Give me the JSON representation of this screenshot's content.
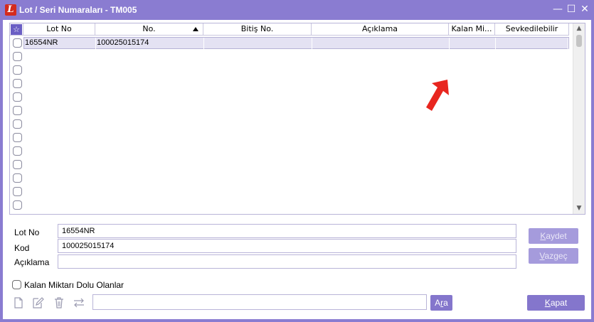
{
  "window": {
    "title": "Lot / Seri Numaraları - TM005",
    "app_icon_letter": "L",
    "minimize_glyph": "—",
    "maximize_glyph": "☐",
    "close_glyph": "✕"
  },
  "grid": {
    "star_glyph": "☆",
    "columns": [
      "Lot No",
      "No.",
      "Bitiş No.",
      "Açıklama",
      "Kalan Mi...",
      "Sevkedilebilir"
    ],
    "sorted_column": "No.",
    "rows": [
      {
        "lot_no": "16554NR",
        "no": "100025015174",
        "bitis_no": "",
        "aciklama": "",
        "kalan": "",
        "sevk": "",
        "checked": false,
        "selected": true
      }
    ],
    "empty_row_count": 12
  },
  "form": {
    "lot_no_label": "Lot No",
    "lot_no_value": "16554NR",
    "kod_label": "Kod",
    "kod_value": "100025015174",
    "aciklama_label": "Açıklama",
    "aciklama_value": "",
    "kalan_filter_label": "Kalan Miktarı Dolu Olanlar",
    "kalan_filter_checked": false,
    "search_value": ""
  },
  "buttons": {
    "kaydet": "Kaydet",
    "kaydet_accel": "K",
    "kaydet_rest": "aydet",
    "vazgec": "Vazgeç",
    "vazgec_accel": "V",
    "vazgec_rest": "azgeç",
    "ara": "Ara",
    "ara_first": "A",
    "ara_accel": "r",
    "ara_rest": "a",
    "kapat": "Kapat",
    "kapat_accel": "K",
    "kapat_rest": "apat"
  },
  "colors": {
    "titlebar": "#8a7cd1",
    "accent": "#8476cc",
    "disabled_button": "#a59bdc",
    "selected_row": "#e4e2f3",
    "annotation_arrow": "#e8261f"
  },
  "icons": [
    "new-document-icon",
    "edit-document-icon",
    "delete-icon",
    "swap-icon",
    "annotation-arrow-icon"
  ]
}
